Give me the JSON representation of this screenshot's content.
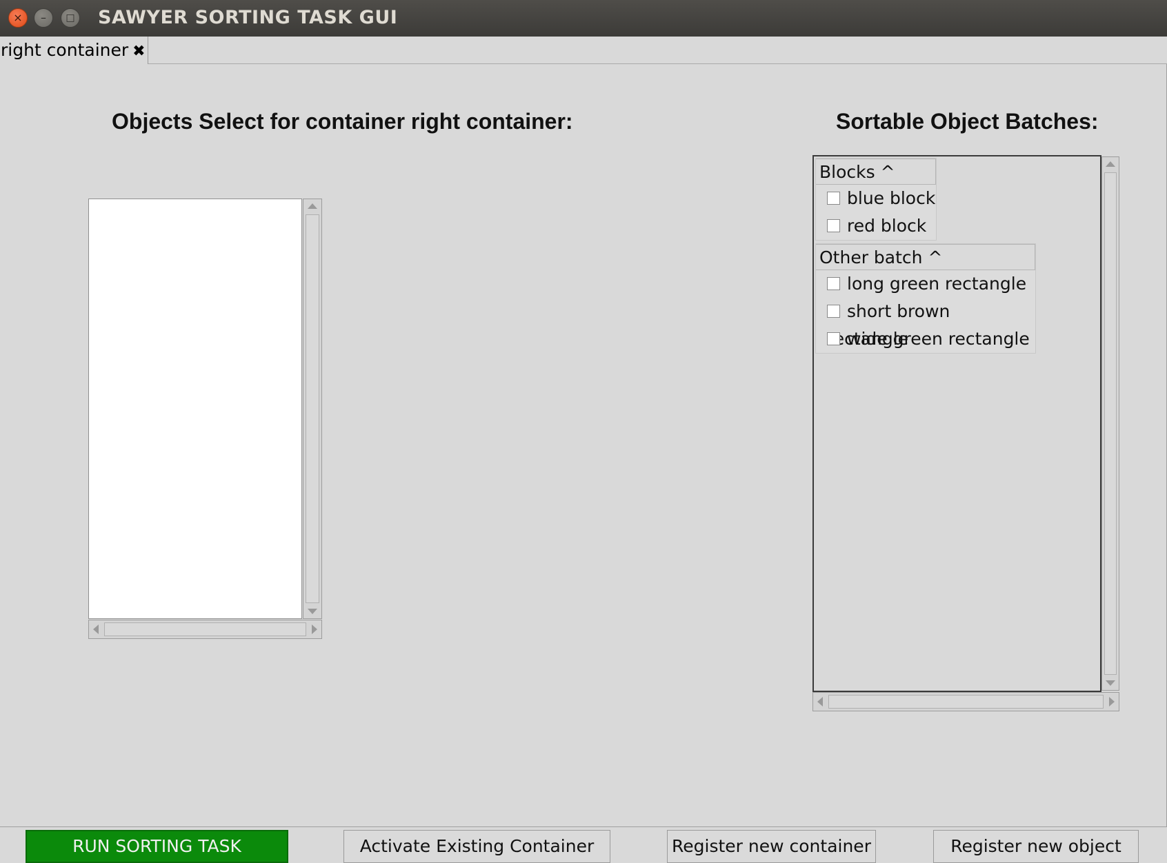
{
  "window": {
    "title": "SAWYER SORTING TASK GUI",
    "close_glyph": "×",
    "minimize_glyph": "–",
    "maximize_glyph": "□"
  },
  "tabs": [
    {
      "label": "right container",
      "close_glyph": "✖"
    }
  ],
  "left_panel": {
    "heading": "Objects Select for container right container:",
    "items": []
  },
  "right_panel": {
    "heading": "Sortable Object Batches:",
    "batches": [
      {
        "name": "Blocks ^",
        "items": [
          {
            "label": "blue block",
            "checked": false
          },
          {
            "label": "red block",
            "checked": false
          }
        ]
      },
      {
        "name": "Other batch ^",
        "items": [
          {
            "label": "long green rectangle",
            "checked": false
          },
          {
            "label": "short brown rectangle",
            "checked": false
          },
          {
            "label": "wide green rectangle",
            "checked": false
          }
        ]
      }
    ]
  },
  "buttons": {
    "run": "RUN SORTING TASK",
    "activate": "Activate Existing Container",
    "register_container": "Register new container",
    "register_object": "Register new object"
  },
  "colors": {
    "run_button_bg": "#0b8a0b",
    "background": "#d9d9d9"
  }
}
